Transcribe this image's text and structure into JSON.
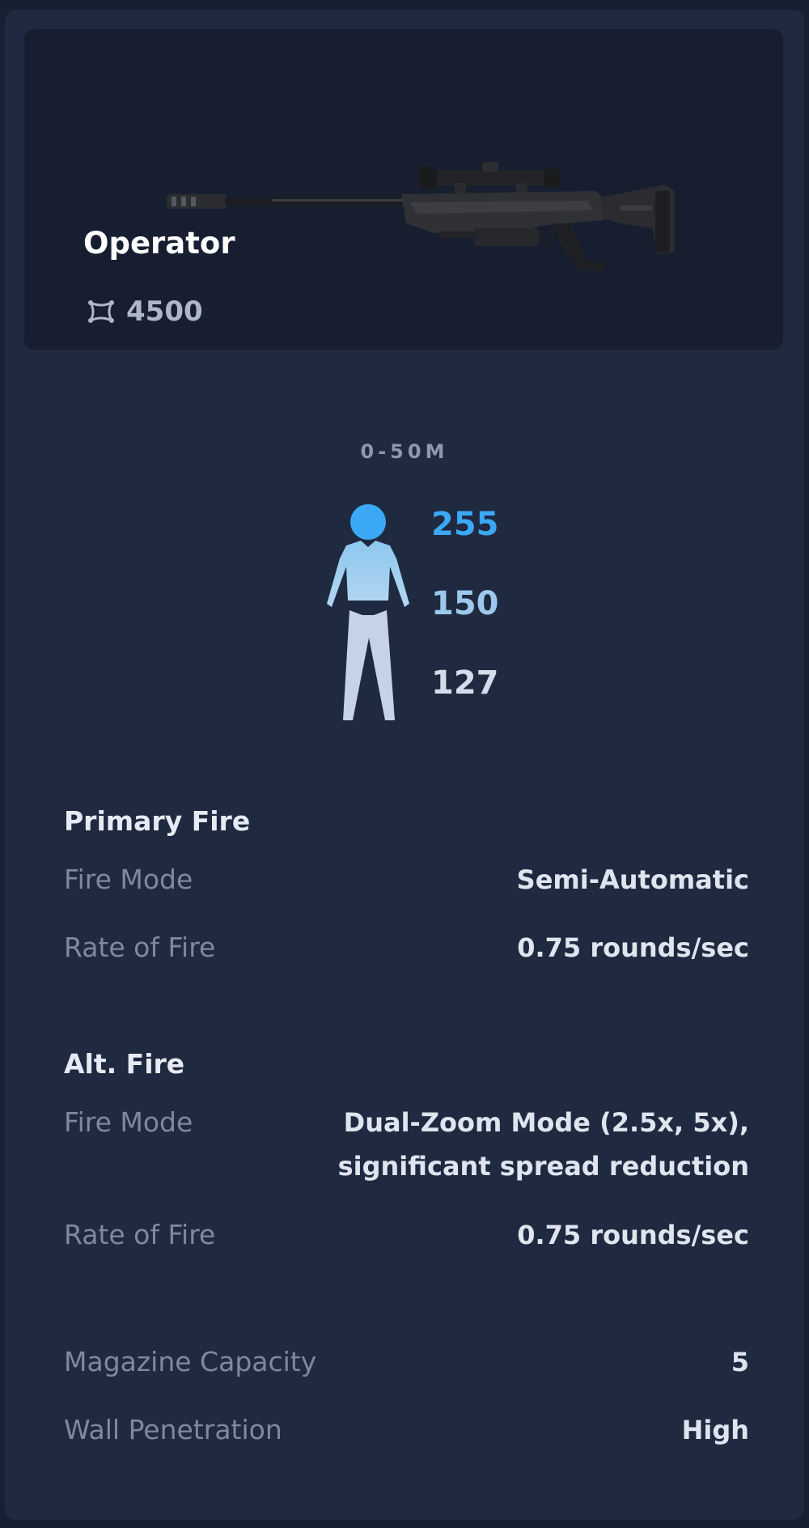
{
  "weapon": {
    "name": "Operator",
    "price": "4500",
    "price_icon": "credits-icon",
    "image": "sniper-rifle-image"
  },
  "damage": {
    "range": "0-50M",
    "head": "255",
    "body": "150",
    "legs": "127",
    "colors": {
      "head": "#3ba8f6",
      "body": "#9cc8ec",
      "legs": "#d3dcea"
    }
  },
  "primary_fire": {
    "title": "Primary Fire",
    "fire_mode_label": "Fire Mode",
    "fire_mode_value": "Semi-Automatic",
    "rate_label": "Rate of Fire",
    "rate_value": "0.75 rounds/sec"
  },
  "alt_fire": {
    "title": "Alt. Fire",
    "fire_mode_label": "Fire Mode",
    "fire_mode_value": "Dual-Zoom Mode (2.5x, 5x), significant spread reduction",
    "rate_label": "Rate of Fire",
    "rate_value": "0.75 rounds/sec"
  },
  "stats": {
    "magazine_label": "Magazine Capacity",
    "magazine_value": "5",
    "penetration_label": "Wall Penetration",
    "penetration_value": "High"
  },
  "theme": {
    "background": "#171f32",
    "card": "#1f2940",
    "hero": "#161e30"
  }
}
